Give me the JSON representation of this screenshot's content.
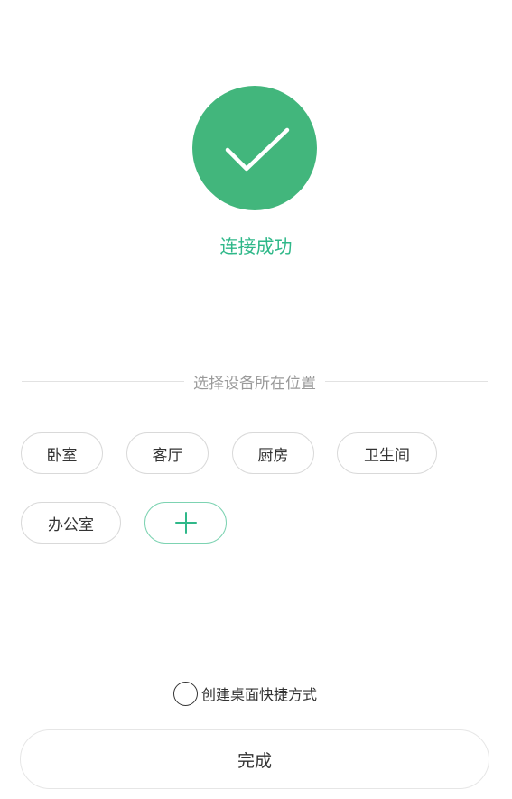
{
  "status": {
    "title": "连接成功",
    "icon": "check-icon",
    "accent_color": "#42b67c",
    "text_color": "#2fb889"
  },
  "location": {
    "section_label": "选择设备所在位置",
    "rooms": [
      {
        "label": "卧室"
      },
      {
        "label": "客厅"
      },
      {
        "label": "厨房"
      },
      {
        "label": "卫生间"
      },
      {
        "label": "办公室"
      }
    ],
    "add_icon": "plus-icon"
  },
  "shortcut": {
    "label": "创建桌面快捷方式",
    "checked": false
  },
  "footer": {
    "done_label": "完成"
  }
}
